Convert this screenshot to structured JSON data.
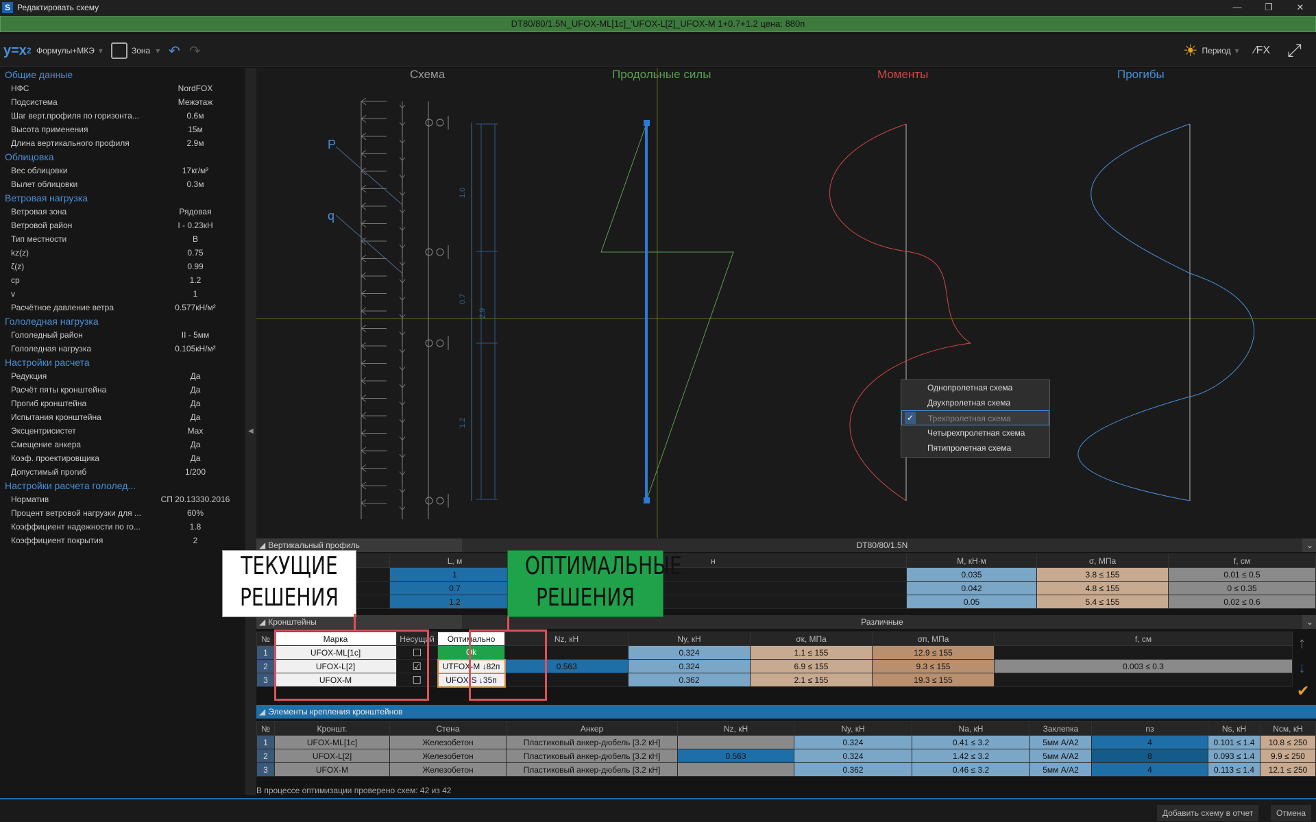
{
  "window": {
    "title": "Редактировать схему"
  },
  "header": {
    "scheme_line": "DT80/80/1.5N_UFOX-ML[1c]_'UFOX-L[2]_UFOX-M   1+0.7+1.2   цена: 880п"
  },
  "toolbar": {
    "formulas": "Формулы+МКЭ",
    "zone": "Зона",
    "period": "Период"
  },
  "sidebar": {
    "sections": [
      {
        "title": "Общие данные",
        "rows": [
          [
            "НФС",
            "NordFOX"
          ],
          [
            "Подсистема",
            "Межэтаж"
          ],
          [
            "Шаг верт.профиля по горизонта...",
            "0.6м"
          ],
          [
            "Высота применения",
            "15м"
          ],
          [
            "Длина вертикального профиля",
            "2.9м"
          ]
        ]
      },
      {
        "title": "Облицовка",
        "rows": [
          [
            "Вес облицовки",
            "17кг/м²"
          ],
          [
            "Вылет облицовки",
            "0.3м"
          ]
        ]
      },
      {
        "title": "Ветровая нагрузка",
        "rows": [
          [
            "Ветровая зона",
            "Рядовая"
          ],
          [
            "Ветровой район",
            "I - 0.23кН"
          ],
          [
            "Тип местности",
            "В"
          ],
          [
            "kz(z)",
            "0.75"
          ],
          [
            "ζ(z)",
            "0.99"
          ],
          [
            "cp",
            "1.2"
          ],
          [
            "v",
            "1"
          ],
          [
            "Расчётное давление ветра",
            "0.577кН/м²"
          ]
        ]
      },
      {
        "title": "Гололедная нагрузка",
        "rows": [
          [
            "Гололедный район",
            "II - 5мм"
          ],
          [
            "Гололедная нагрузка",
            "0.105кН/м²"
          ]
        ]
      },
      {
        "title": "Настройки расчета",
        "rows": [
          [
            "Редукция",
            "Да"
          ],
          [
            "Расчёт пяты кронштейна",
            "Да"
          ],
          [
            "Прогиб кронштейна",
            "Да"
          ],
          [
            "Испытания кронштейна",
            "Да"
          ],
          [
            "Эксцентрисистет",
            "Max"
          ],
          [
            "Смещение анкера",
            "Да"
          ],
          [
            "Коэф. проектировщика",
            "Да"
          ],
          [
            "Допустимый прогиб",
            "1/200"
          ]
        ]
      },
      {
        "title": "Настройки расчета гололед...",
        "rows": [
          [
            "Норматив",
            "СП 20.13330.2016"
          ],
          [
            "Процент ветровой нагрузки для ...",
            "60%"
          ],
          [
            "Коэффициент надежности по го...",
            "1.8"
          ],
          [
            "Коэффициент покрытия",
            "2"
          ]
        ]
      }
    ]
  },
  "diagram": {
    "titles": [
      "Схема",
      "Продольные силы",
      "Моменты",
      "Прогибы"
    ],
    "title_colors": [
      "#9a9a9a",
      "#5aa050",
      "#d04848",
      "#4a8fd8"
    ],
    "p": "P",
    "q": "q",
    "spans": [
      "1.0",
      "0.7",
      "1.2"
    ],
    "total": "2.9"
  },
  "context_menu": {
    "items": [
      "Однопролетная схема",
      "Двухпролетная схема",
      "Трехпролетная схема",
      "Четырехпролетная схема",
      "Пятипролетная схема"
    ],
    "selected_index": 2
  },
  "vertical": {
    "label": "Вертикальный профиль",
    "value": "DT80/80/1.5N",
    "cols": [
      "L, м",
      "н",
      "М, кН·м",
      "σ, МПа",
      "f, см"
    ],
    "rows": [
      [
        "1",
        "0.035",
        "3.8 ≤ 155",
        "0.01 ≤ 0.5"
      ],
      [
        "0.7",
        "0.042",
        "4.8 ≤ 155",
        "0 ≤ 0.35"
      ],
      [
        "1.2",
        "0.05",
        "5.4 ≤ 155",
        "0.02 ≤ 0.6"
      ]
    ]
  },
  "brackets": {
    "label": "Кронштейны",
    "value": "Различные",
    "cols": [
      "№",
      "Марка",
      "Несущий",
      "Оптимально",
      "Nz, кН",
      "Ny, кН",
      "σк, МПа",
      "σп, МПа",
      "f, см"
    ],
    "rows": [
      [
        "1",
        "UFOX-ML[1c]",
        false,
        "Ok",
        "",
        "0.324",
        "1.1 ≤ 155",
        "12.9 ≤ 155",
        ""
      ],
      [
        "2",
        "UFOX-L[2]",
        true,
        "UTFOX-M ↓82п",
        "0.563",
        "0.324",
        "6.9 ≤ 155",
        "9.3 ≤ 155",
        "0.003 ≤ 0.3"
      ],
      [
        "3",
        "UFOX-M",
        false,
        "UFOX-S ↓35п",
        "",
        "0.362",
        "2.1 ≤ 155",
        "19.3 ≤ 155",
        ""
      ]
    ]
  },
  "fastening": {
    "label": "Элементы крепления кронштейнов",
    "cols": [
      "№",
      "Кроншт.",
      "Стена",
      "Анкер",
      "Nz, кН",
      "Ny, кН",
      "Na, кН",
      "Заклепка",
      "nз",
      "Ns, кН",
      "Nсм, кН"
    ],
    "rows": [
      [
        "1",
        "UFOX-ML[1c]",
        "Железобетон",
        "Пластиковый анкер-дюбель [3.2 кН]",
        "",
        "0.324",
        "0.41 ≤ 3.2",
        "5мм A/A2",
        "4",
        "0.101 ≤ 1.4",
        "10.8 ≤ 250"
      ],
      [
        "2",
        "UFOX-L[2]",
        "Железобетон",
        "Пластиковый анкер-дюбель [3.2 кН]",
        "0.563",
        "0.324",
        "1.42 ≤ 3.2",
        "5мм A/A2",
        "8",
        "0.093 ≤ 1.4",
        "9.9 ≤ 250"
      ],
      [
        "3",
        "UFOX-M",
        "Железобетон",
        "Пластиковый анкер-дюбель [3.2 кН]",
        "",
        "0.362",
        "0.46 ≤ 3.2",
        "5мм A/A2",
        "4",
        "0.113 ≤ 1.4",
        "12.1 ≤ 250"
      ]
    ]
  },
  "callouts": {
    "current": "ТЕКУЩИЕ\nРЕШЕНИЯ",
    "optimal": "ОПТИМАЛЬНЫЕ\nРЕШЕНИЯ"
  },
  "status": "В процессе оптимизации проверено схем: 42 из 42",
  "buttons": {
    "add": "Добавить схему в отчет",
    "cancel": "Отмена"
  },
  "colors": {
    "accent": "#1e6ea8",
    "green": "#1fa24a",
    "callout_border": "#e0505a"
  }
}
